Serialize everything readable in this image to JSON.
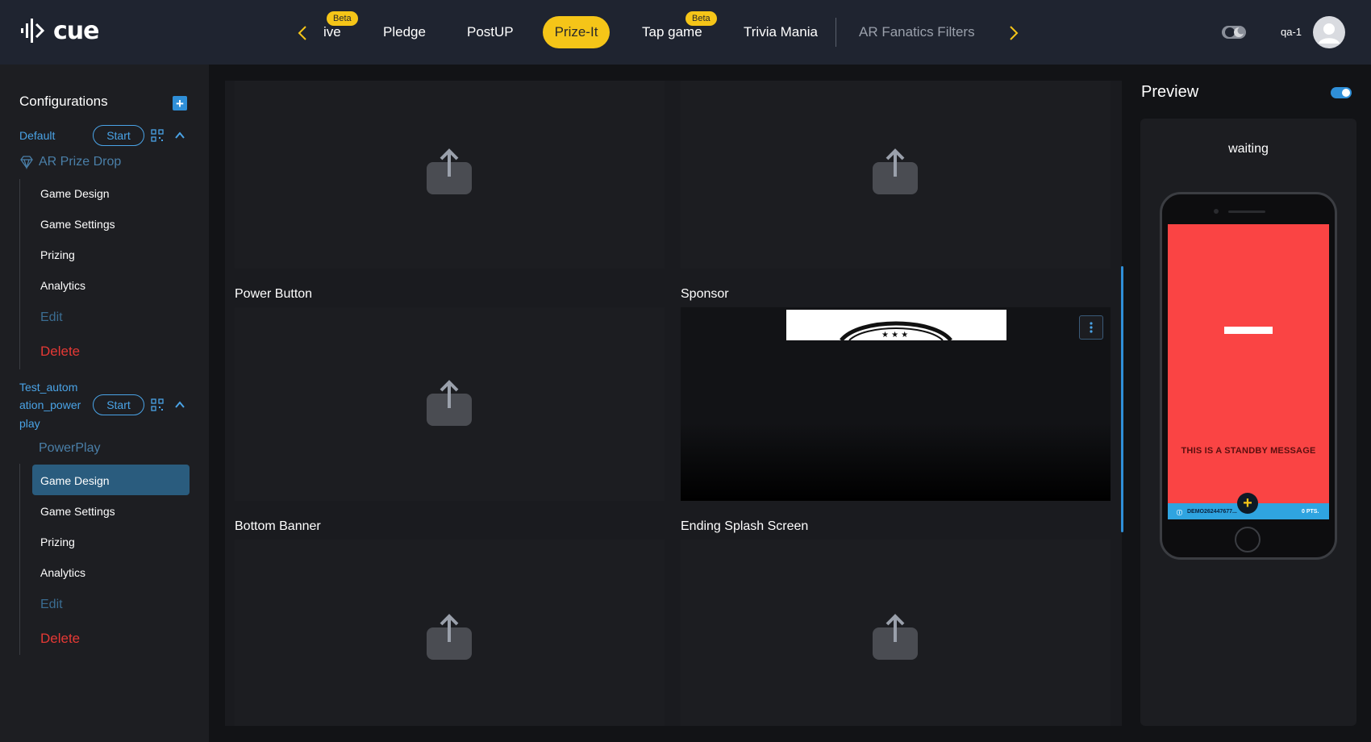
{
  "app": {
    "logo_text": "cue"
  },
  "nav": {
    "tabs": [
      {
        "label": "ive",
        "beta": "Beta"
      },
      {
        "label": "Pledge"
      },
      {
        "label": "PostUP"
      },
      {
        "label": "Prize-It",
        "active": true
      },
      {
        "label": "Tap game",
        "beta": "Beta"
      },
      {
        "label": "Trivia Mania"
      },
      {
        "label": "AR Fanatics Filters",
        "muted": true
      }
    ]
  },
  "user": {
    "name": "qa-1"
  },
  "sidebar": {
    "heading": "Configurations",
    "configs": [
      {
        "name": "Default",
        "start_label": "Start",
        "game_type": "AR Prize Drop",
        "items": [
          "Game Design",
          "Game Settings",
          "Prizing",
          "Analytics"
        ],
        "edit": "Edit",
        "delete": "Delete"
      },
      {
        "name_lines": [
          "Test_autom",
          "ation_power",
          "play"
        ],
        "start_label": "Start",
        "game_type": "PowerPlay",
        "items": [
          "Game Design",
          "Game Settings",
          "Prizing",
          "Analytics"
        ],
        "active_item": "Game Design",
        "edit": "Edit",
        "delete": "Delete"
      }
    ]
  },
  "main": {
    "sections": [
      {
        "label": "Power Button"
      },
      {
        "label": "Sponsor"
      },
      {
        "label": "Bottom Banner"
      },
      {
        "label": "Ending Splash Screen"
      }
    ]
  },
  "preview": {
    "title": "Preview",
    "status": "waiting",
    "standby_message": "THIS IS A STANDBY MESSAGE",
    "footer_id": "DEMO262447677...",
    "footer_points": "0 PTS."
  },
  "colors": {
    "accent": "#2f8fd8",
    "brand_yellow": "#f5c518",
    "danger": "#e53935",
    "phone_screen": "#fa4444"
  }
}
